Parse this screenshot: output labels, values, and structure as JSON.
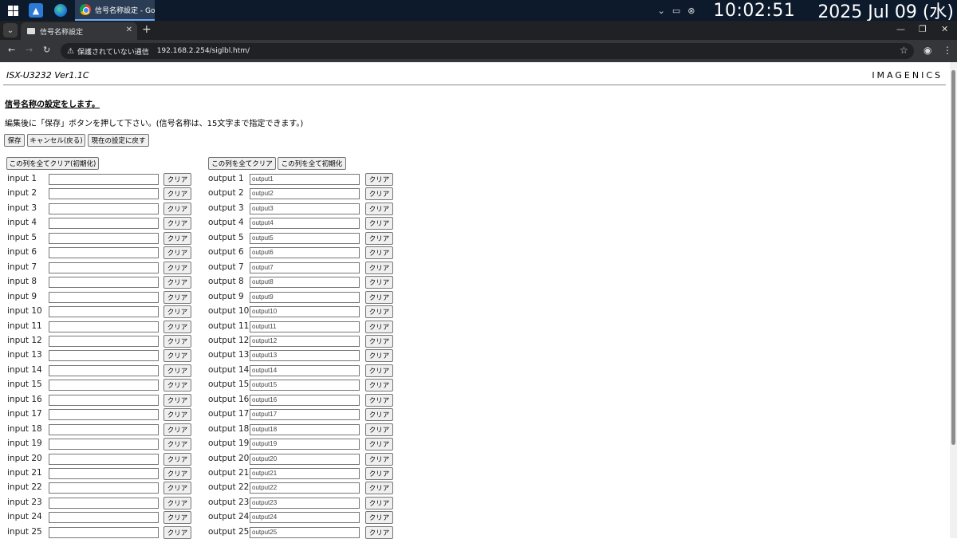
{
  "taskbar": {
    "chrome_task_title": "信号名称設定 - Goo...",
    "time": "10:02:51",
    "date": "2025  Jul 09 (水)"
  },
  "browser": {
    "tab_title": "信号名称設定",
    "insecure_label": "保護されていない通信",
    "url": "192.168.2.254/siglbl.htm/"
  },
  "page": {
    "model": "ISX-U3232   Ver1.1C",
    "brand": "IMAGENICS",
    "title": "信号名称の設定をします。",
    "notice": "編集後に「保存」ボタンを押して下さい。(信号名称は、15文字まで指定できます。)",
    "buttons": {
      "save": "保存",
      "cancel": "キャンセル(戻る)",
      "revert": "現在の設定に戻す"
    },
    "input_col": {
      "clear_all": "この列を全てクリア(初期化)"
    },
    "output_col": {
      "clear_all": "この列を全てクリア",
      "init_all": "この列を全て初期化"
    },
    "clear_label": "クリア",
    "inputs": [
      {
        "label": "input 1",
        "value": ""
      },
      {
        "label": "input 2",
        "value": ""
      },
      {
        "label": "input 3",
        "value": ""
      },
      {
        "label": "input 4",
        "value": ""
      },
      {
        "label": "input 5",
        "value": ""
      },
      {
        "label": "input 6",
        "value": ""
      },
      {
        "label": "input 7",
        "value": ""
      },
      {
        "label": "input 8",
        "value": ""
      },
      {
        "label": "input 9",
        "value": ""
      },
      {
        "label": "input 10",
        "value": ""
      },
      {
        "label": "input 11",
        "value": ""
      },
      {
        "label": "input 12",
        "value": ""
      },
      {
        "label": "input 13",
        "value": ""
      },
      {
        "label": "input 14",
        "value": ""
      },
      {
        "label": "input 15",
        "value": ""
      },
      {
        "label": "input 16",
        "value": ""
      },
      {
        "label": "input 17",
        "value": ""
      },
      {
        "label": "input 18",
        "value": ""
      },
      {
        "label": "input 19",
        "value": ""
      },
      {
        "label": "input 20",
        "value": ""
      },
      {
        "label": "input 21",
        "value": ""
      },
      {
        "label": "input 22",
        "value": ""
      },
      {
        "label": "input 23",
        "value": ""
      },
      {
        "label": "input 24",
        "value": ""
      },
      {
        "label": "input 25",
        "value": ""
      }
    ],
    "outputs": [
      {
        "label": "output 1",
        "value": "output1"
      },
      {
        "label": "output 2",
        "value": "output2"
      },
      {
        "label": "output 3",
        "value": "output3"
      },
      {
        "label": "output 4",
        "value": "output4"
      },
      {
        "label": "output 5",
        "value": "output5"
      },
      {
        "label": "output 6",
        "value": "output6"
      },
      {
        "label": "output 7",
        "value": "output7"
      },
      {
        "label": "output 8",
        "value": "output8"
      },
      {
        "label": "output 9",
        "value": "output9"
      },
      {
        "label": "output 10",
        "value": "output10"
      },
      {
        "label": "output 11",
        "value": "output11"
      },
      {
        "label": "output 12",
        "value": "output12"
      },
      {
        "label": "output 13",
        "value": "output13"
      },
      {
        "label": "output 14",
        "value": "output14"
      },
      {
        "label": "output 15",
        "value": "output15"
      },
      {
        "label": "output 16",
        "value": "output16"
      },
      {
        "label": "output 17",
        "value": "output17"
      },
      {
        "label": "output 18",
        "value": "output18"
      },
      {
        "label": "output 19",
        "value": "output19"
      },
      {
        "label": "output 20",
        "value": "output20"
      },
      {
        "label": "output 21",
        "value": "output21"
      },
      {
        "label": "output 22",
        "value": "output22"
      },
      {
        "label": "output 23",
        "value": "output23"
      },
      {
        "label": "output 24",
        "value": "output24"
      },
      {
        "label": "output 25",
        "value": "output25"
      }
    ]
  }
}
